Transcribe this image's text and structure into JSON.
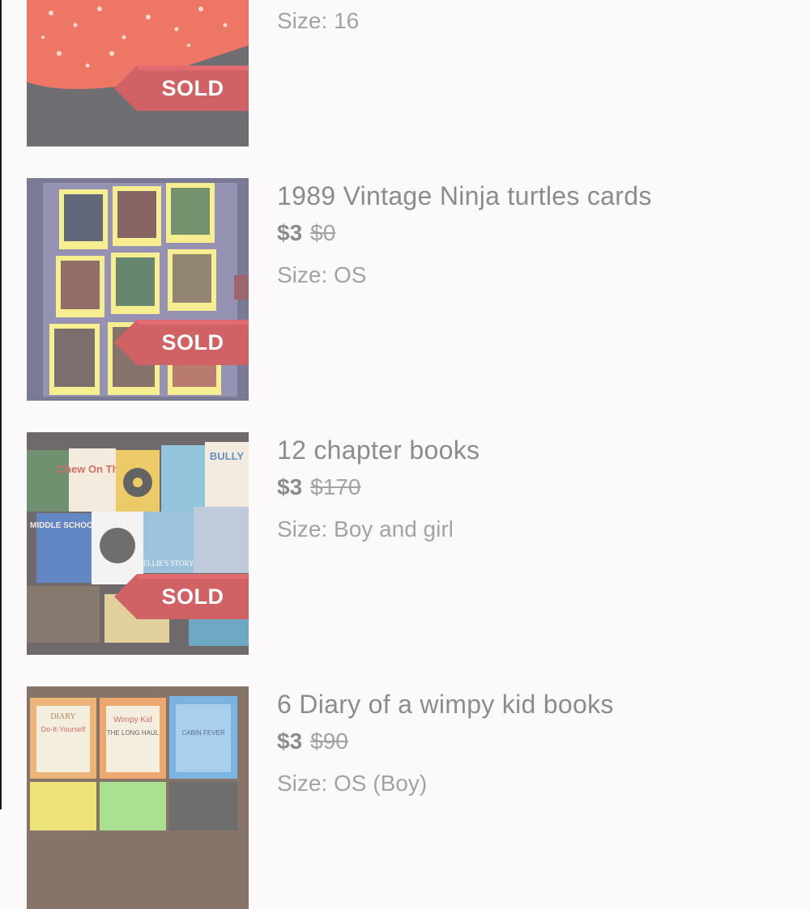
{
  "listings": [
    {
      "title": "",
      "price": "",
      "original_price": "",
      "size": "Size: 16",
      "sold_badge": "SOLD",
      "image": "red-floral-dress-photo"
    },
    {
      "title": "1989 Vintage Ninja turtles cards",
      "price": "$3",
      "original_price": "$0",
      "size": "Size: OS",
      "sold_badge": "SOLD",
      "image": "trading-cards-binder-photo"
    },
    {
      "title": "12 chapter books",
      "price": "$3",
      "original_price": "$170",
      "size": "Size: Boy and girl",
      "sold_badge": "SOLD",
      "image": "chapter-books-photo",
      "book_titles": [
        "Chew On This",
        "BULLY",
        "MIDDLE SCHOOL",
        "ELLIE'S STORY"
      ]
    },
    {
      "title": "6 Diary of a wimpy kid books",
      "price": "$3",
      "original_price": "$90",
      "size": "Size: OS (Boy)",
      "sold_badge": "",
      "image": "wimpy-kid-books-photo",
      "book_titles": [
        "DIARY",
        "Wimpy Kid",
        "Do-It-Yourself",
        "THE LONG HAUL",
        "CABIN FEVER"
      ]
    }
  ],
  "colors": {
    "background": "#fbf9fa",
    "title_text": "#8d8b8c",
    "muted_text": "#a4a2a3",
    "sold_ribbon": "#c0272d"
  }
}
